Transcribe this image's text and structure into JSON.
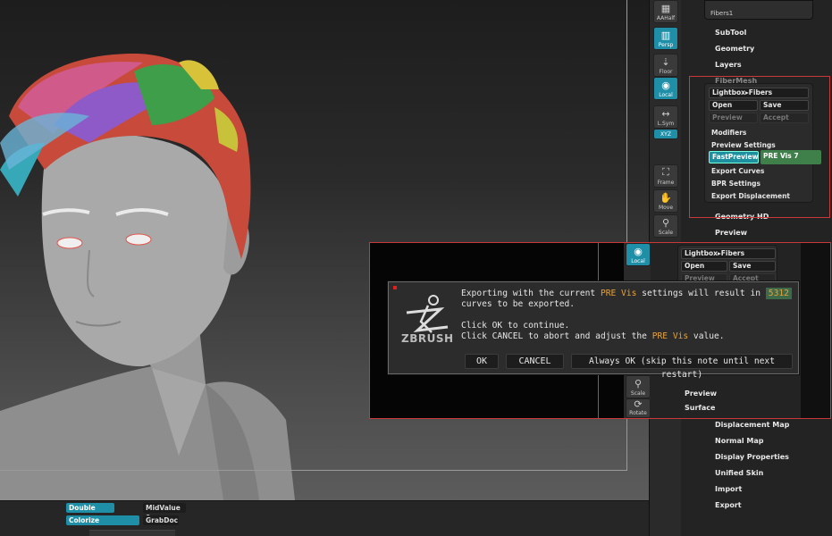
{
  "shelf": {
    "aahalf": "AAHalf",
    "persp": "Persp",
    "floor": "Floor",
    "local": "Local",
    "lsym": "L.Sym",
    "xyz": "XYZ",
    "frame": "Frame",
    "move": "Move",
    "scale": "Scale",
    "rotate": "Rotate"
  },
  "palette": {
    "thumb_label": "Fibers1",
    "subtool": "SubTool",
    "geometry": "Geometry",
    "layers": "Layers",
    "fibermesh": "FiberMesh",
    "geometry_hd": "Geometry HD",
    "preview": "Preview",
    "surface": "Surface",
    "displacement_map": "Displacement Map",
    "normal_map": "Normal Map",
    "display_properties": "Display Properties",
    "unified_skin": "Unified Skin",
    "import": "Import",
    "export": "Export"
  },
  "fiber": {
    "lightbox": "Lightbox▸Fibers",
    "open": "Open",
    "save": "Save",
    "preview": "Preview",
    "accept": "Accept",
    "modifiers": "Modifiers",
    "preview_settings": "Preview Settings",
    "fastpreview": "FastPreview",
    "pre_vis": "PRE Vis 7",
    "export_curves": "Export Curves",
    "bpr_settings": "BPR Settings",
    "export_displacement": "Export Displacement"
  },
  "dialog": {
    "line1_a": "Exporting with the current ",
    "line1_hl": "PRE Vis",
    "line1_b": " settings will result in ",
    "line1_num": "5312",
    "line2": "curves to be exported.",
    "line3": "Click OK to continue.",
    "line4_a": "Click CANCEL to abort and adjust the ",
    "line4_hl": "PRE Vis",
    "line4_b": " value.",
    "ok": "OK",
    "cancel": "CANCEL",
    "always_ok": "Always OK (skip this note until next restart)",
    "logo": "ZBRUSH"
  },
  "bottom": {
    "double": "Double",
    "colorize": "Colorize",
    "midvalue": "MidValue 0",
    "grabdoc": "GrabDoc"
  },
  "colors": {
    "accent": "#1f8fa8",
    "highlight_box": "#c83a3a",
    "warning_text": "#e8a23a"
  }
}
